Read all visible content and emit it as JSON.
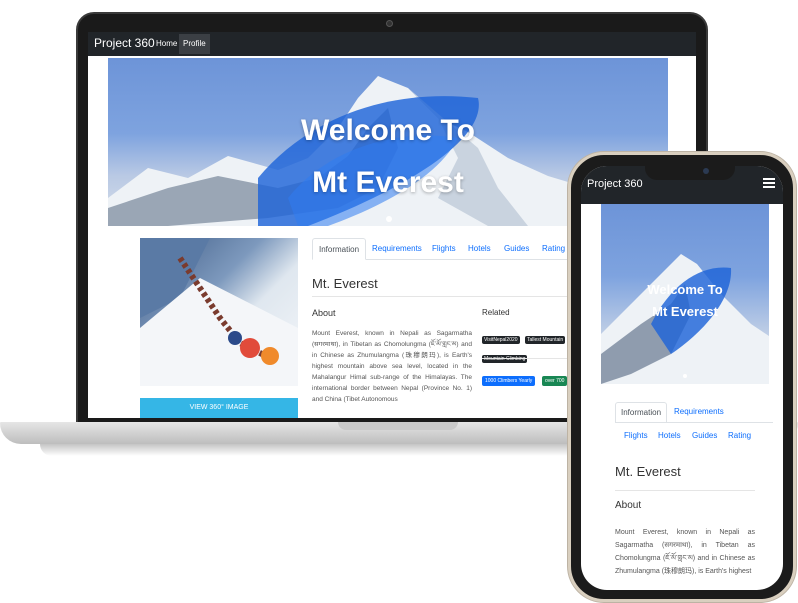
{
  "laptop": {
    "navbar": {
      "brand": "Project 360",
      "links": [
        "Home",
        "Profile"
      ]
    },
    "hero": {
      "title_line1": "Welcome To",
      "title_line2": "Mt Everest"
    },
    "view_button": "VIEW 360° IMAGE",
    "tabs": [
      "Information",
      "Requirements",
      "Flights",
      "Hotels",
      "Guides",
      "Rating"
    ],
    "page_title": "Mt. Everest",
    "about_heading": "About",
    "about_text": "Mount Everest, known in Nepali as Sagarmatha (सगरमाथा), in Tibetan as Chomolungma (ཇོ་མོ་གླང་མ) and in Chinese as Zhumulangma (珠穆朗玛), is Earth's highest mountain above sea level, located in the Mahalangur Himal sub-range of the Himalayas. The international border between Nepal (Province No. 1) and China (Tibet Autonomous",
    "related_heading": "Related",
    "tags": [
      "VisitNepal2020",
      "Tallest Mountain",
      "Mountain Climbing"
    ],
    "stats": [
      "1000 Climbers Yearly",
      "over 700"
    ]
  },
  "phone": {
    "navbar": {
      "brand": "Project 360"
    },
    "hero": {
      "title_line1": "Welcome To",
      "title_line2": "Mt Everest"
    },
    "tabs": [
      "Information",
      "Requirements",
      "Flights",
      "Hotels",
      "Guides",
      "Rating"
    ],
    "page_title": "Mt. Everest",
    "about_heading": "About",
    "about_text": "Mount Everest, known in Nepali as Sagarmatha (सगरमाथा), in Tibetan as Chomolungma (ཇོ་མོ་གླང་མ) and in Chinese as Zhumulangma (珠穆朗玛), is Earth's highest"
  },
  "colors": {
    "navbar": "#212529",
    "accent_blue": "#0d6efd",
    "button_cyan": "#35b6e6",
    "success_green": "#198754"
  }
}
